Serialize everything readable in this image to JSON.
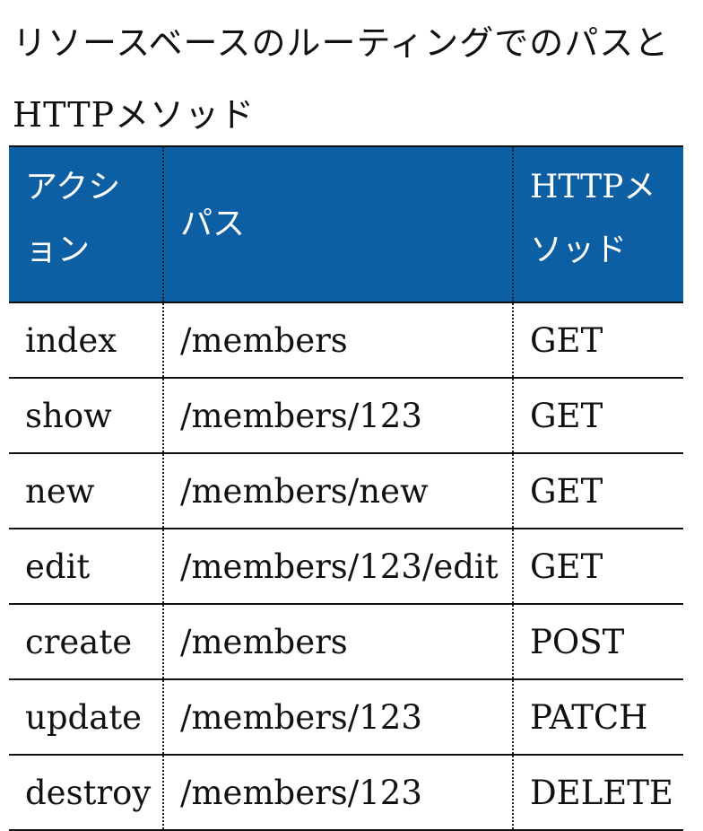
{
  "title": "リソースベースのルーティングでのパスとHTTPメソッド",
  "table": {
    "headers": [
      "アクション",
      "パス",
      "HTTPメソッド"
    ],
    "rows": [
      {
        "action": "index",
        "path": "/members",
        "method": "GET"
      },
      {
        "action": "show",
        "path": "/members/123",
        "method": "GET"
      },
      {
        "action": "new",
        "path": "/members/new",
        "method": "GET"
      },
      {
        "action": "edit",
        "path": "/members/123/edit",
        "method": "GET"
      },
      {
        "action": "create",
        "path": "/members",
        "method": "POST"
      },
      {
        "action": "update",
        "path": "/members/123",
        "method": "PATCH"
      },
      {
        "action": "destroy",
        "path": "/members/123",
        "method": "DELETE"
      }
    ]
  },
  "colors": {
    "header_background": "#0d5fa3",
    "header_text": "#ffffff"
  }
}
